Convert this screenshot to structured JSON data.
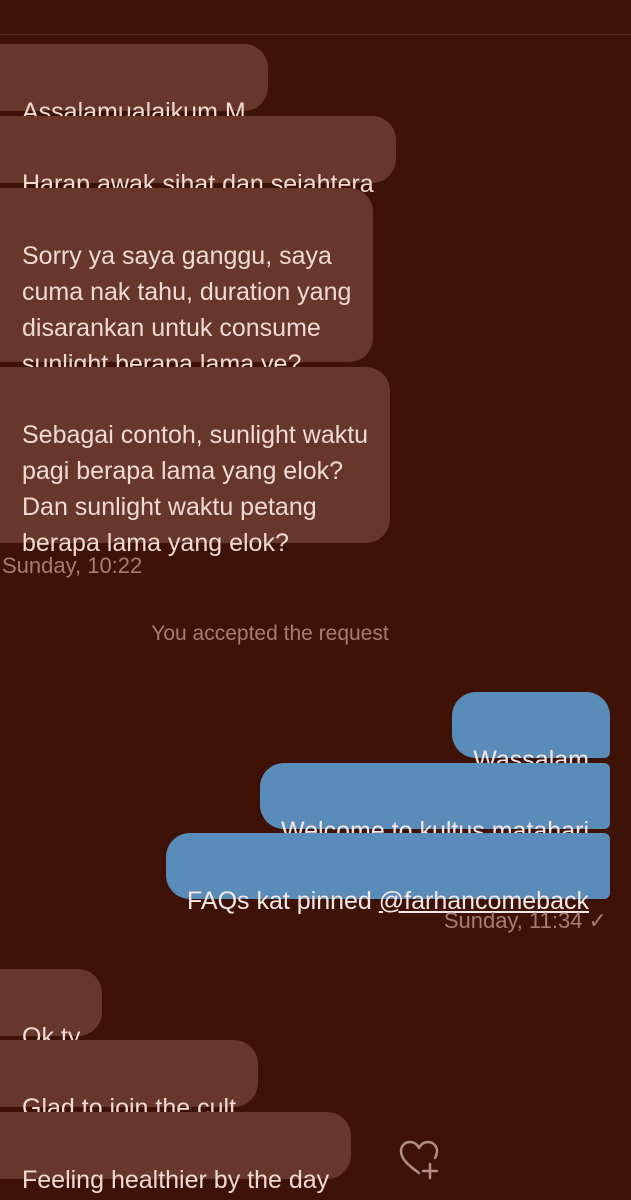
{
  "incoming_group_1": [
    {
      "text": "Assalamualaikum M"
    },
    {
      "text": "Harap awak sihat dan sejahtera"
    },
    {
      "text": "Sorry ya saya ganggu, saya\ncuma nak tahu, duration yang\ndisarankan untuk consume\nsunlight berapa lama ye?"
    },
    {
      "text": "Sebagai contoh, sunlight waktu\npagi berapa lama yang elok?\nDan sunlight waktu petang\nberapa lama yang elok?"
    }
  ],
  "timestamp_1": "Sunday, 10:22",
  "system_message": "You accepted the request",
  "outgoing_group": [
    {
      "text": "Wassalam"
    },
    {
      "text": "Welcome to kultus matahari"
    },
    {
      "prefix": "FAQs kat pinned ",
      "mention": "@farhancomeback"
    }
  ],
  "timestamp_2": "Sunday, 11:34 ✓",
  "incoming_group_2": [
    {
      "text": "Ok ty"
    },
    {
      "text": "Glad to join the cult"
    },
    {
      "text": "Feeling healthier by the day"
    }
  ],
  "icons": {
    "react": "heart-plus-icon"
  },
  "colors": {
    "background": "#3f1208",
    "incoming_bubble": "#66372a",
    "outgoing_bubble": "#5a8cba",
    "meta_text": "#a57d72"
  }
}
